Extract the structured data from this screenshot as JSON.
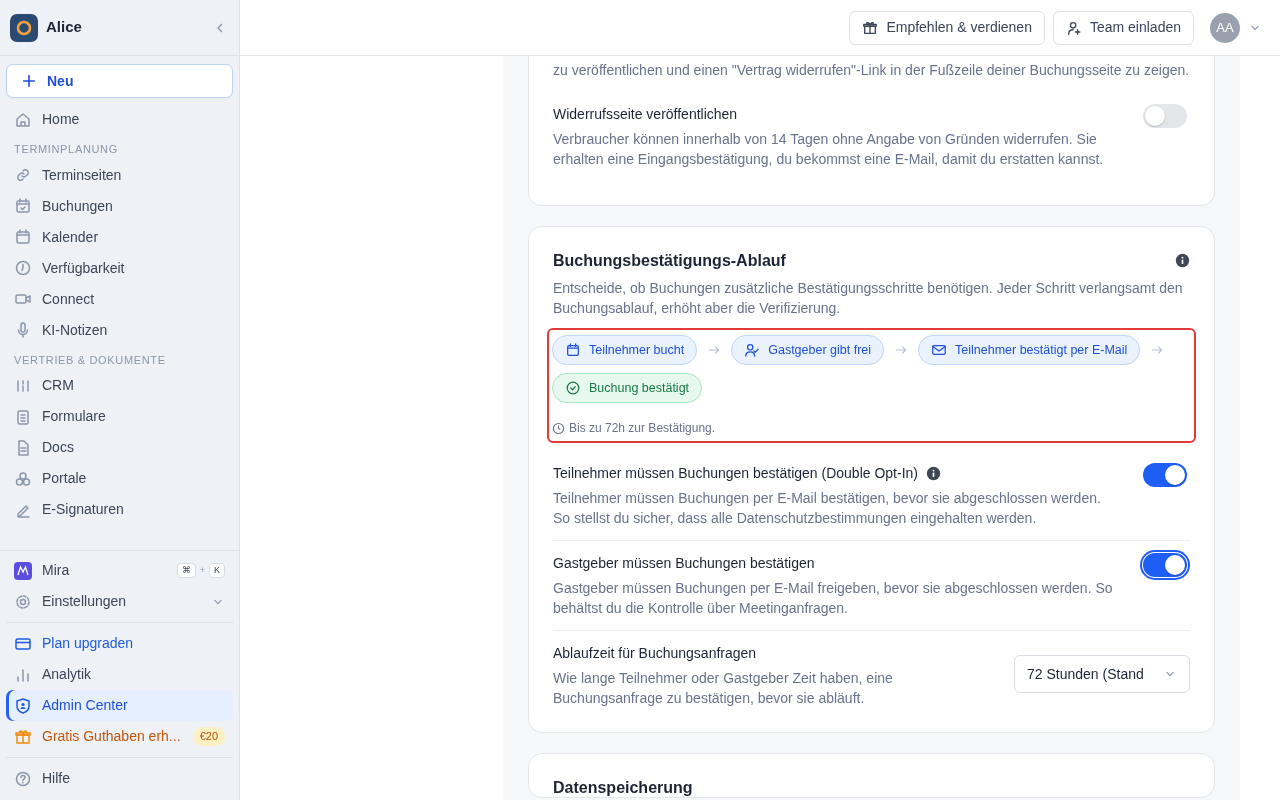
{
  "sidebar": {
    "workspace": "Alice",
    "new_button": "Neu",
    "nav": [
      {
        "label": "Home",
        "selected": false
      },
      {
        "heading": "TERMINPLANUNG"
      },
      {
        "label": "Terminseiten",
        "selected": false
      },
      {
        "label": "Buchungen",
        "selected": false
      },
      {
        "label": "Kalender",
        "selected": false
      },
      {
        "label": "Verfügbarkeit",
        "selected": false
      },
      {
        "label": "Connect",
        "selected": false
      },
      {
        "label": "KI-Notizen",
        "selected": false
      },
      {
        "heading": "VERTRIEB & DOKUMENTE"
      },
      {
        "label": "CRM",
        "selected": false
      },
      {
        "label": "Formulare",
        "selected": false
      },
      {
        "label": "Docs",
        "selected": false
      },
      {
        "label": "Portale",
        "selected": false
      },
      {
        "label": "E-Signaturen",
        "selected": false
      }
    ],
    "assistant": {
      "label": "Mira",
      "keys": [
        "⌘",
        "+",
        "K"
      ]
    },
    "settings": {
      "label": "Einstellungen",
      "expanded": false
    },
    "bottom": [
      {
        "label": "Plan upgraden",
        "kind": "upgrade",
        "selected": false
      },
      {
        "label": "Analytik",
        "kind": "plain",
        "selected": false
      },
      {
        "label": "Admin Center",
        "kind": "plain",
        "selected": true
      },
      {
        "label": "Gratis Guthaben erh...",
        "kind": "promo",
        "badge": "€20",
        "selected": false
      }
    ],
    "help": "Hilfe"
  },
  "header": {
    "buttons": [
      "Empfehlen & verdienen",
      "Team einladen"
    ],
    "avatar": "AA"
  },
  "withdrawal_card": {
    "intro": "zu veröffentlichen und einen \"Vertrag widerrufen\"-Link in der Fußzeile deiner Buchungsseite zu zeigen.",
    "setting": {
      "title": "Widerrufsseite veröffentlichen",
      "description": "Verbraucher können innerhalb von 14 Tagen ohne Angabe von Gründen widerrufen. Sie erhalten eine Eingangsbestätigung, du bekommst eine E-Mail, damit du erstatten kannst.",
      "on": false,
      "focused": false
    }
  },
  "flow_card": {
    "title": "Buchungsbestätigungs-Ablauf",
    "description": "Entscheide, ob Buchungen zusätzliche Bestätigungsschritte benötigen. Jeder Schritt verlangsamt den Buchungsablauf, erhöht aber die Verifizierung.",
    "highlighted": true,
    "steps": [
      {
        "label": "Teilnehmer bucht",
        "kind": "step"
      },
      {
        "label": "Gastgeber gibt frei",
        "kind": "step"
      },
      {
        "label": "Teilnehmer bestätigt per E-Mail",
        "kind": "step"
      },
      {
        "label": "Buchung bestätigt",
        "kind": "done"
      }
    ],
    "note": "Bis zu 72h zur Bestätigung.",
    "settings": [
      {
        "kind": "toggle",
        "title": "Teilnehmer müssen Buchungen bestätigen (Double Opt-In)",
        "info": true,
        "description": "Teilnehmer müssen Buchungen per E-Mail bestätigen, bevor sie abgeschlossen werden.\nSo stellst du sicher, dass alle Datenschutzbestimmungen eingehalten werden.",
        "on": true,
        "focused": false
      },
      {
        "kind": "toggle",
        "title": "Gastgeber müssen Buchungen bestätigen",
        "info": false,
        "description": "Gastgeber müssen Buchungen per E-Mail freigeben, bevor sie abgeschlossen werden. So behältst du die Kontrolle über Meetinganfragen.",
        "on": true,
        "focused": true
      },
      {
        "kind": "select",
        "title": "Ablaufzeit für Buchungsanfragen",
        "info": false,
        "description": "Wie lange Teilnehmer oder Gastgeber Zeit haben, eine Buchungsanfrage zu bestätigen, bevor sie abläuft.",
        "value": "72 Stunden (Stand"
      }
    ]
  },
  "next_card": {
    "title": "Datenspeicherung"
  }
}
